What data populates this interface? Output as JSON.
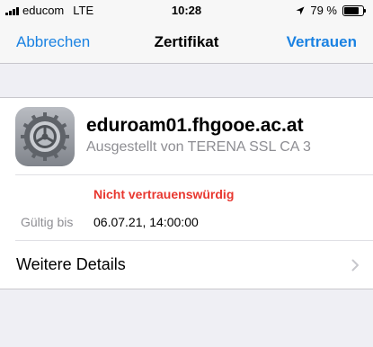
{
  "status_bar": {
    "carrier": "educom",
    "network": "LTE",
    "time": "10:28",
    "battery": "79 %",
    "battery_level": 0.79
  },
  "nav": {
    "cancel_label": "Abbrechen",
    "title": "Zertifikat",
    "trust_label": "Vertrauen"
  },
  "certificate": {
    "icon": "gear-icon",
    "name": "eduroam01.fhgooe.ac.at",
    "issuer": "Ausgestellt von TERENA SSL CA 3",
    "trust_status": "Nicht vertrauenswürdig",
    "valid_label": "Gültig bis",
    "valid_until": "06.07.21, 14:00:00"
  },
  "details": {
    "label": "Weitere Details"
  },
  "colors": {
    "accent": "#1a82e2",
    "warning": "#e8372f",
    "secondary_text": "#8e8e93"
  }
}
